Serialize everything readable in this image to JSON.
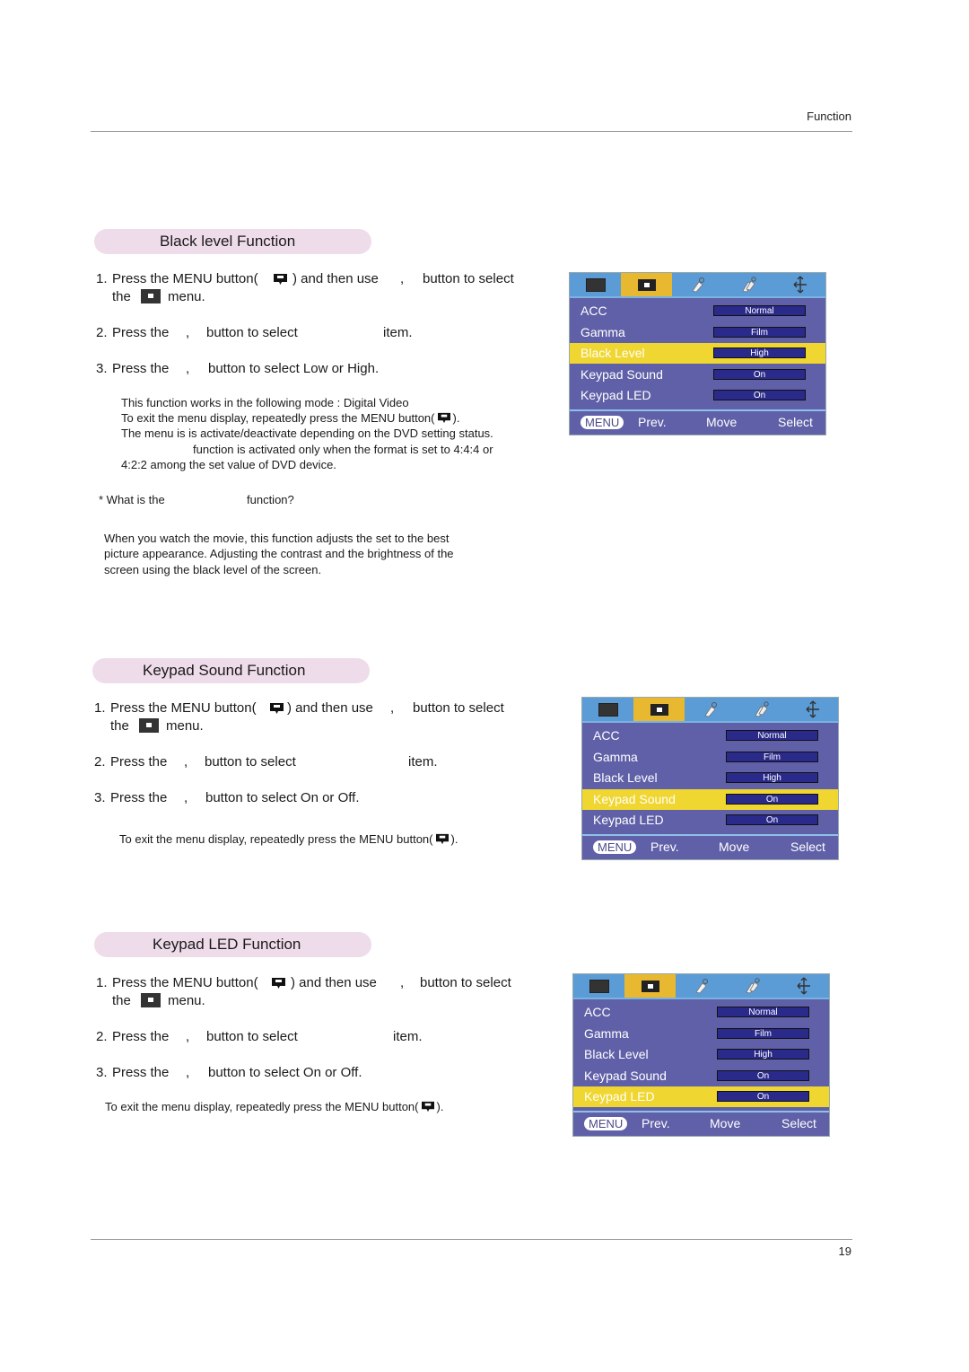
{
  "header": {
    "section": "Function"
  },
  "footer": {
    "page_number": "19"
  },
  "icons": {
    "menu_button": "menu-button-icon",
    "picture_menu": "picture-menu-icon"
  },
  "sections": [
    {
      "title": "Black level Function",
      "steps": [
        {
          "num": "1.",
          "a": "Press the MENU button(",
          "b": ") and then use",
          "c": ",",
          "d": "button to select",
          "e": "the",
          "f": "menu."
        },
        {
          "num": "2.",
          "a": "Press the",
          "c": ",",
          "d": "button to select",
          "e": "item."
        },
        {
          "num": "3.",
          "a": "Press the",
          "c": ",",
          "d": "button to select Low or High."
        }
      ],
      "notes": [
        "This function works in the following mode : Digital Video",
        "To exit the menu display, repeatedly press the MENU button(",
        ").",
        "The menu is is activate/deactivate depending on the DVD setting status.",
        "function is activated only when the format is set to  4:4:4 or",
        "4:2:2 among the set value of DVD device."
      ],
      "question": {
        "prefix": "* What is the",
        "suffix": "function?"
      },
      "answer": [
        "When you watch the movie, this function adjusts the set to the best",
        "picture appearance. Adjusting the contrast and the brightness of the",
        "screen using the black level of the screen."
      ]
    },
    {
      "title": "Keypad Sound Function",
      "steps": [
        {
          "num": "1.",
          "a": "Press the MENU button(",
          "b": ") and then use",
          "c": ",",
          "d": "button to select",
          "e": "the",
          "f": "menu."
        },
        {
          "num": "2.",
          "a": "Press the",
          "c": ",",
          "d": "button to select",
          "e": "item."
        },
        {
          "num": "3.",
          "a": "Press the",
          "c": ",",
          "d": "button to select On or Off."
        }
      ],
      "notes": [
        "To exit the menu display, repeatedly press the MENU button(",
        ")."
      ]
    },
    {
      "title": "Keypad LED Function",
      "steps": [
        {
          "num": "1.",
          "a": "Press the MENU button(",
          "b": ") and then use",
          "c": ",",
          "d": "button to select",
          "e": "the",
          "f": "menu."
        },
        {
          "num": "2.",
          "a": "Press the",
          "c": ",",
          "d": "button to select",
          "e": "item."
        },
        {
          "num": "3.",
          "a": "Press the",
          "c": ",",
          "d": "button to select On or Off."
        }
      ],
      "notes": [
        "To exit the menu display, repeatedly press the MENU button(",
        ")."
      ]
    }
  ],
  "osd": {
    "tabs": [
      "screen-tab-icon",
      "picture-tab-icon",
      "tag-tab-icon",
      "multi-tag-tab-icon",
      "move-tab-icon"
    ],
    "active_tab": 1,
    "items": [
      {
        "label": "ACC",
        "value": "Normal"
      },
      {
        "label": "Gamma",
        "value": "Film"
      },
      {
        "label": "Black Level",
        "value": "High"
      },
      {
        "label": "Keypad Sound",
        "value": "On"
      },
      {
        "label": "Keypad LED",
        "value": "On"
      }
    ],
    "footer": {
      "menu": "MENU",
      "prev": "Prev.",
      "move": "Move",
      "select": "Select"
    },
    "highlight": [
      2,
      3,
      4
    ],
    "colors": {
      "body": "#6060a8",
      "tabs": "#5b9bd6",
      "active_tab": "#e8b830",
      "highlight": "#f0d630",
      "value_box": "#2a2a8a"
    }
  }
}
